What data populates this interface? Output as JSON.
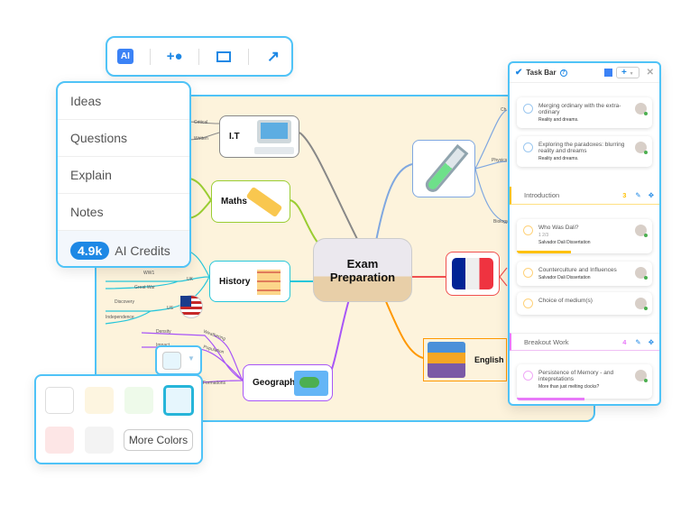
{
  "toolbar": {
    "items": [
      {
        "name": "ai",
        "label": "AI"
      },
      {
        "name": "add-user"
      },
      {
        "name": "presentation"
      },
      {
        "name": "export"
      }
    ]
  },
  "ai_menu": {
    "items": [
      "Ideas",
      "Questions",
      "Explain",
      "Notes"
    ],
    "credits_value": "4.9k",
    "credits_label": "AI Credits"
  },
  "mindmap": {
    "center": "Exam\nPreparation",
    "nodes": {
      "it": "I.T",
      "maths": "Maths",
      "history": "History",
      "geography": "Geography",
      "english": "English"
    },
    "labels": {
      "it1": "Critical",
      "it2": "Written",
      "h1": "WW1",
      "h2": "Great War",
      "h3": "UK",
      "h4": "Discovery",
      "h5": "Independence",
      "h6": "US",
      "g1": "Density",
      "g2": "Impact",
      "g3": "Weathering",
      "g4": "Population",
      "g5": "Formations",
      "s1": "Ch",
      "s2": "Physics",
      "s3": "Biology"
    },
    "colors": {
      "it": "#888888",
      "maths": "#9acd32",
      "history": "#26c6da",
      "geography": "#a855f7",
      "science": "#7fa7e0",
      "french": "#f05050",
      "english": "#ff9800"
    }
  },
  "task_bar": {
    "title": "Task Bar",
    "cards_top": [
      {
        "title": "Merging ordinary with the extra-ordinary",
        "sub": "Reality and dreams."
      },
      {
        "title": "Exploring the paradoxes: blurring reality and dreams",
        "sub": "Reality and dreams."
      }
    ],
    "sections": [
      {
        "name": "Introduction",
        "count": "3",
        "color": "#ffc107",
        "cards": [
          {
            "title": "Who Was Dali?",
            "meta": "1   2/3",
            "sub": "Salvador Dali Dissertation",
            "progress": 0.4
          },
          {
            "title": "Counterculture and Influences",
            "sub": "Salvador Dali Dissertation"
          },
          {
            "title": "Choice of medium(s)",
            "sub": ""
          }
        ]
      },
      {
        "name": "Breakout Work",
        "count": "4",
        "color": "#e879f9",
        "cards": [
          {
            "title": "Persistence of Memory - and intepretations",
            "sub": "More than just melting clocks?",
            "progress": 0.5
          }
        ]
      }
    ]
  },
  "color_picker": {
    "selected": "#e6f6fd",
    "swatches": [
      "#ffffff",
      "#fdf5e0",
      "#eefaea",
      "#e6f6fd",
      "#fde6e6",
      "#f3f3f3"
    ],
    "more_label": "More Colors"
  }
}
